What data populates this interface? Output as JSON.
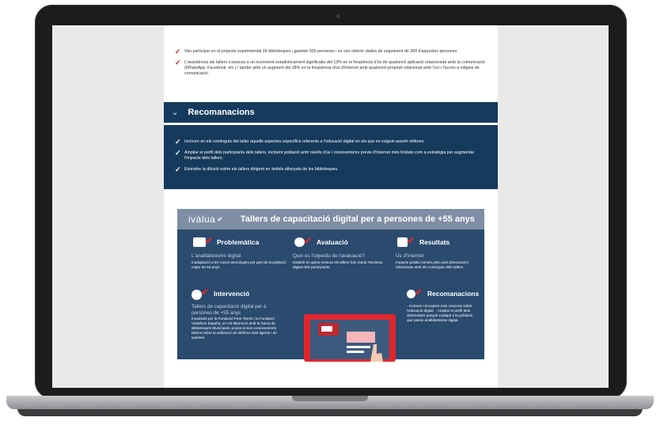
{
  "top_list": [
    "Van participar en el projecte experimental 16 biblioteques i gairebé 500 persones i es van obtenir dades de seguiment de 300 d'aquestes persones.",
    "L'assistència als tallers s'associa a un increment estadísticament significatiu del 13% en la freqüència d'ús de qualsevol aplicació relacionada amb la comunicació (WhatsApp, Facebook, etc.) i també amb un augment del 18% en la freqüència d'ús d'Internet amb qualsevol propòsit relacionat amb l'oci i l'accés a mitjans de comunicació."
  ],
  "recommendations": {
    "chevron": "⌄",
    "title": "Recomanacions",
    "items": [
      "Incloure en els continguts del taller aquells aspectes específics referents a l'educació digital en els que es vulguin assolir millores.",
      "Ampliar el perfil dels participants dels tallers, incloent població amb nivells d'ús i coneixements previs d'Internet més limitats com a estratègia per augmentar l'impacte dels tallers.",
      "Estendre la difusió sobre els tallers dirigent en àmbits allunyats de les biblioteques."
    ]
  },
  "infographic": {
    "brand": "ivàlua",
    "title": "Tallers de capacitació digital per a persones de +55 anys",
    "problematica": {
      "title": "Problemàtica",
      "lead": "L'analfabetisme digital",
      "text": "Inadaptació a les noves tecnologies per part de la població major de 55 anys."
    },
    "avaluacio": {
      "title": "Avaluació",
      "lead": "Quin és l'objectiu de l'avaluació?",
      "text": "Establir en quina mesura els tallers han reduït l'escletxa digital dels participants."
    },
    "resultats": {
      "title": "Resultats",
      "lead": "Ús d'Internet",
      "text": "Impacte positiu només pels usos directament relacionats amb els continguts dels tallers."
    },
    "intervencio": {
      "title": "Intervenció",
      "lead": "Tallers de capacitació digital per a persones de +55 anys",
      "text": "Impulsats per la Fundació Pere Tarrés i la Fundació Vodafone España, en col·laboració amb la Xarxa de Biblioteques Municipals, proporcionen coneixements bàsics sobre la utilització de telèfons intel·ligents i de tauletes."
    },
    "recomanacions": {
      "title": "Recomanacions",
      "text": "· Incloure conceptes més concrets sobre l'educació digital. · Ampliar el perfil dels destinataris perquè s'adapti a la població que pateix analfabetisme digital."
    }
  },
  "icons": {
    "check": "✓",
    "brand_check": "✔"
  },
  "colors": {
    "navy": "#163a5c",
    "accent_red": "#c2272d"
  }
}
